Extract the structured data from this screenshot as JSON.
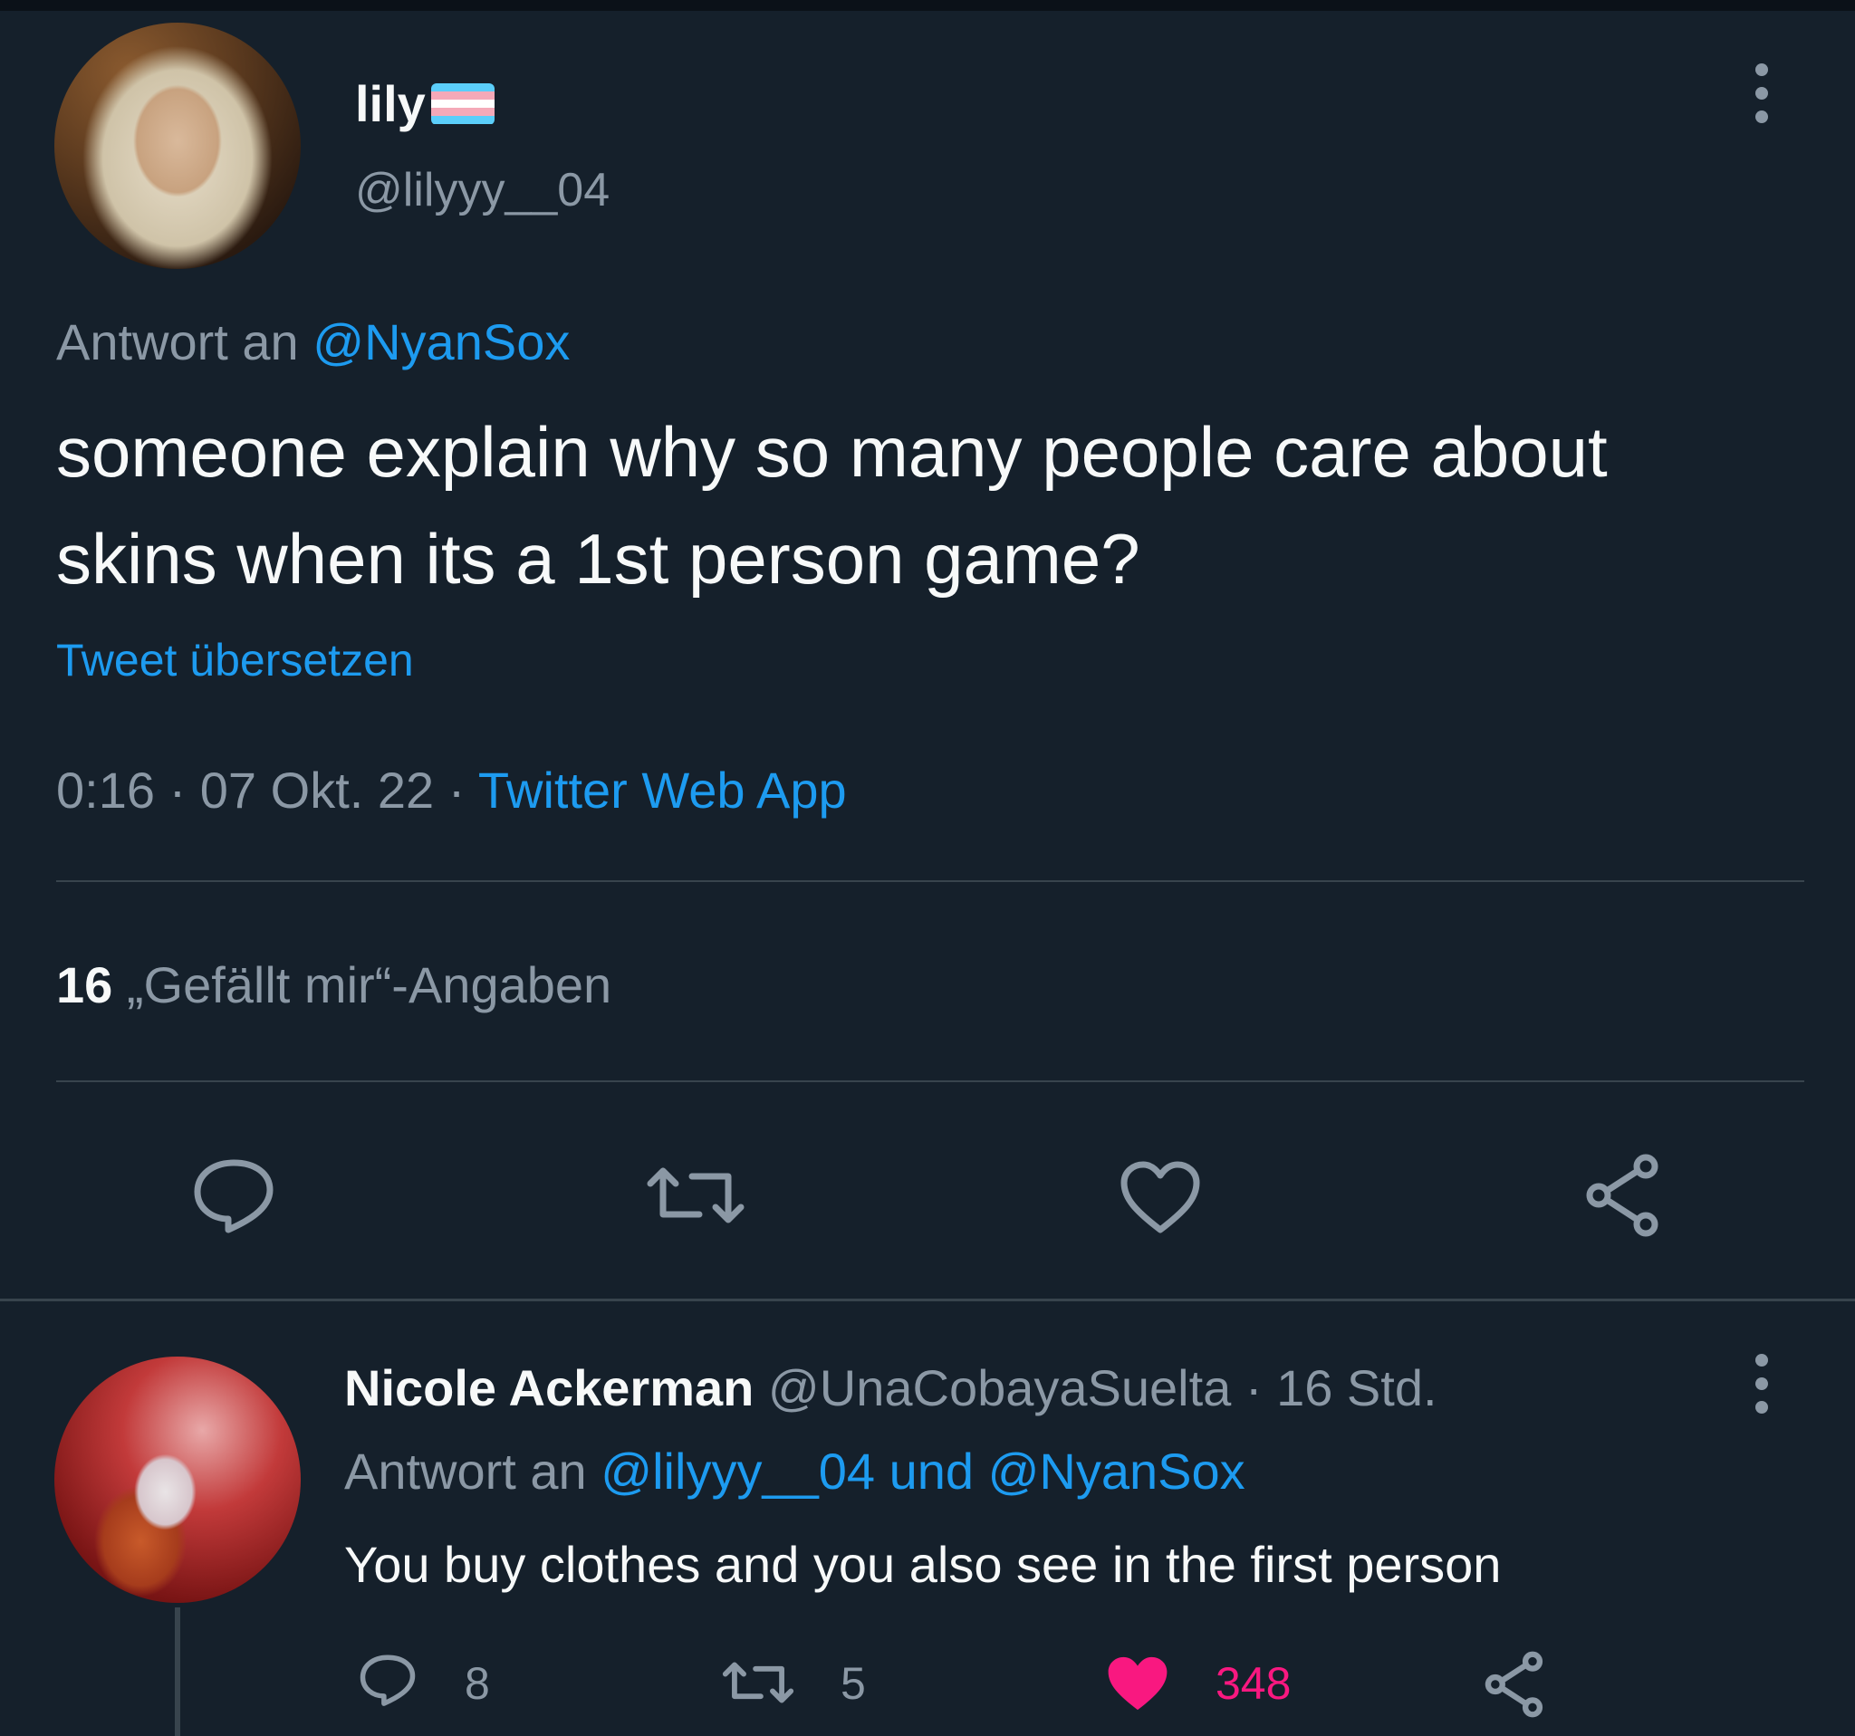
{
  "main_tweet": {
    "display_name": "lily",
    "handle": "@lilyyy__04",
    "reply_prefix": "Antwort an",
    "reply_target": "@NyanSox",
    "text": "someone explain why so many people care about skins when its a 1st person game?",
    "translate_label": "Tweet übersetzen",
    "time": "0:16",
    "separator": "·",
    "date": "07 Okt. 22",
    "source": "Twitter Web App",
    "likes_count": "16",
    "likes_label": "„Gefällt mir“-Angaben",
    "flag_colors": [
      "#5bcefa",
      "#f5a9b8",
      "#ffffff",
      "#f5a9b8",
      "#5bcefa"
    ]
  },
  "reply_tweet": {
    "display_name": "Nicole Ackerman",
    "handle": "@UnaCobayaSuelta",
    "time_ago": "· 16 Std.",
    "reply_prefix": "Antwort an",
    "reply_targets": "@lilyyy__04 und @NyanSox",
    "text": "You buy clothes and you also see in the first person",
    "reply_count": "8",
    "retweet_count": "5",
    "like_count": "348"
  },
  "colors": {
    "background": "#15202b",
    "link": "#1d9bf0",
    "muted": "#8b98a5",
    "like_active": "#f91880",
    "divider": "#38444d"
  },
  "icons": [
    "reply-icon",
    "retweet-icon",
    "like-icon",
    "share-icon",
    "more-icon"
  ]
}
